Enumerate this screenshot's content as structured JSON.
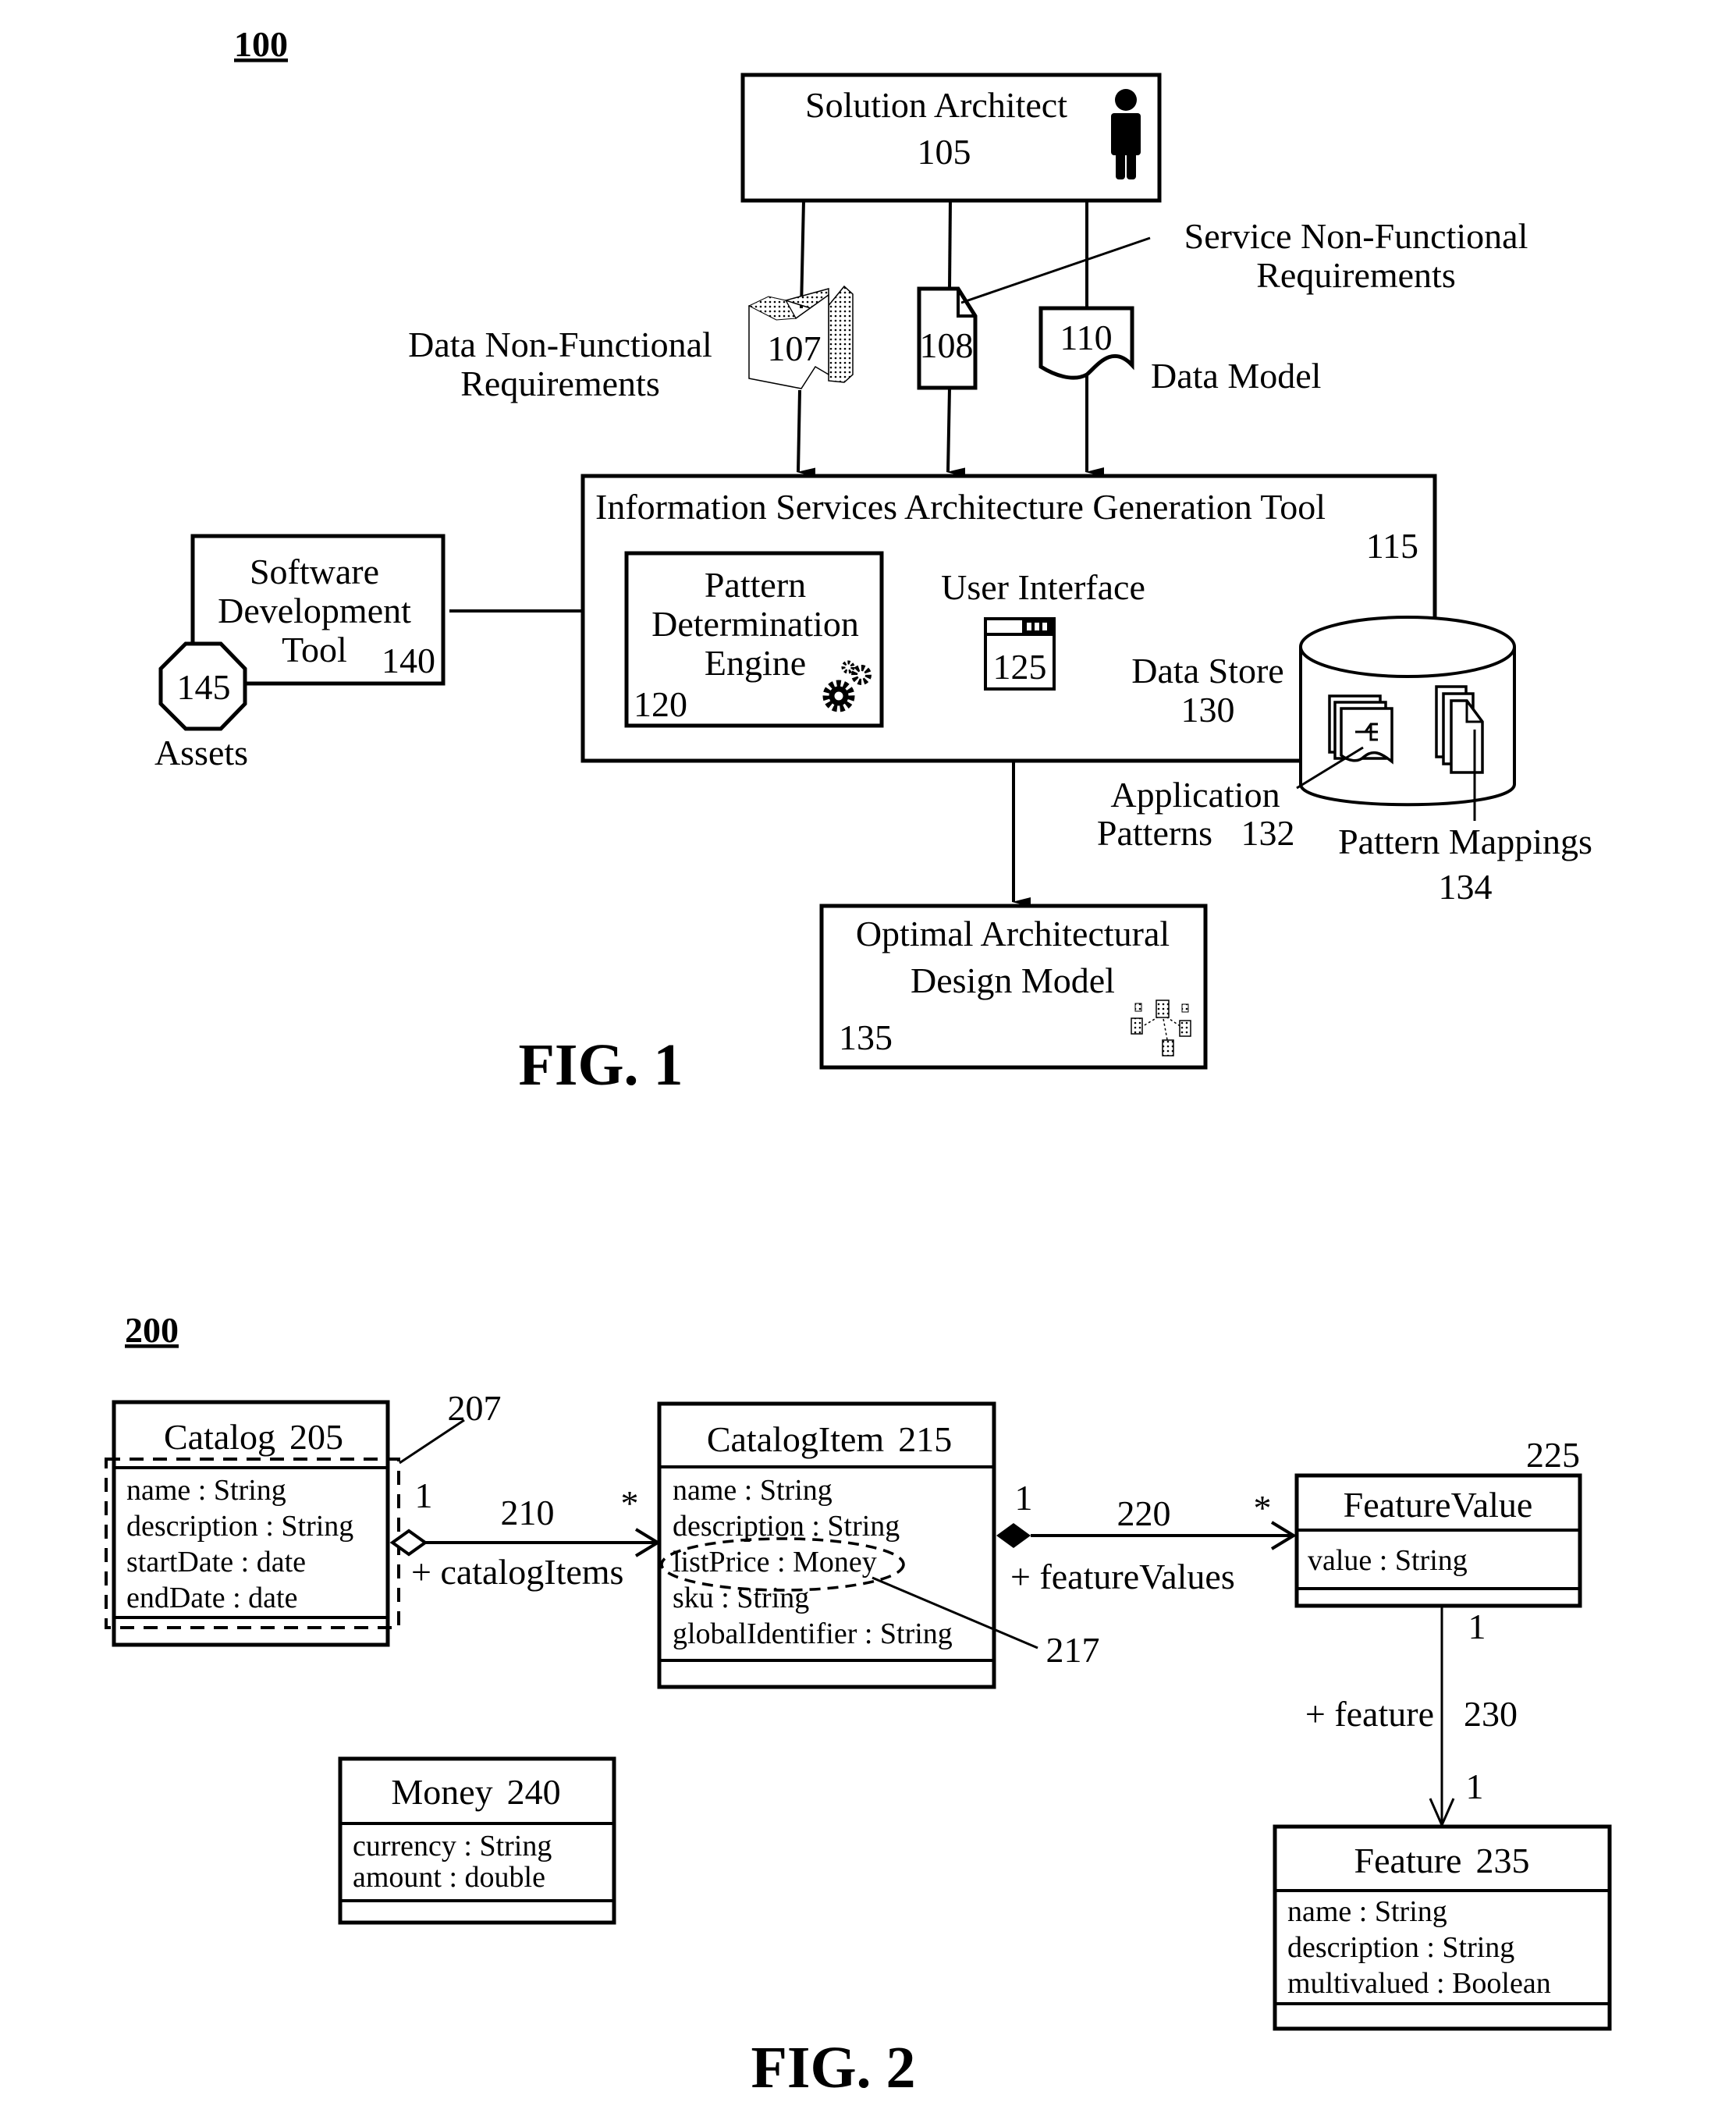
{
  "fig1": {
    "ref": "100",
    "caption": "FIG. 1",
    "solution_architect": {
      "title": "Solution Architect",
      "num": "105",
      "icon": "person-icon"
    },
    "doc107": {
      "num": "107",
      "label_line1": "Data Non-Functional",
      "label_line2": "Requirements",
      "icon": "dotted-document-icon"
    },
    "doc108": {
      "num": "108",
      "label_line1": "Service Non-Functional",
      "label_line2": "Requirements",
      "icon": "folded-document-icon"
    },
    "doc110": {
      "num": "110",
      "label": "Data Model",
      "icon": "wavy-document-icon"
    },
    "tool": {
      "title": "Information Services Architecture Generation Tool",
      "num": "115"
    },
    "engine": {
      "line1": "Pattern",
      "line2": "Determination",
      "line3": "Engine",
      "num": "120",
      "icon": "gears-icon"
    },
    "ui": {
      "label": "User Interface",
      "num": "125",
      "icon": "window-icon"
    },
    "datastore": {
      "line1": "Data Store",
      "num": "130",
      "icon": "database-cylinder-icon"
    },
    "app_patterns": {
      "line1": "Application",
      "line2": "Patterns",
      "num": "132",
      "icon": "stacked-pattern-documents-icon"
    },
    "pattern_mappings": {
      "line1": "Pattern Mappings",
      "num": "134",
      "icon": "stacked-pages-icon"
    },
    "optimal": {
      "line1": "Optimal Architectural",
      "line2": "Design Model",
      "num": "135",
      "icon": "model-graph-icon"
    },
    "sdt": {
      "line1": "Software",
      "line2": "Development",
      "line3": "Tool",
      "num": "140"
    },
    "assets": {
      "num": "145",
      "label": "Assets",
      "icon": "octagon-icon"
    }
  },
  "fig2": {
    "ref": "200",
    "caption": "FIG. 2",
    "catalog": {
      "name": "Catalog",
      "num": "205",
      "attrs": [
        "name : String",
        "description : String",
        "startDate : date",
        "endDate : date"
      ]
    },
    "callout207": "207",
    "assoc210": {
      "num": "210",
      "src_mult": "1",
      "dst_mult": "*",
      "role": "+ catalogItems"
    },
    "catalog_item": {
      "name": "CatalogItem",
      "num": "215",
      "attrs": [
        "name : String",
        "description : String",
        "listPrice : Money",
        "sku : String",
        "globalIdentifier : String"
      ]
    },
    "callout217": "217",
    "assoc220": {
      "num": "220",
      "src_mult": "1",
      "dst_mult": "*",
      "role": "+ featureValues"
    },
    "feature_value": {
      "name": "FeatureValue",
      "num": "225",
      "attrs": [
        "value : String"
      ]
    },
    "assoc230": {
      "num": "230",
      "src_mult": "1",
      "dst_mult": "1",
      "role": "+ feature"
    },
    "feature": {
      "name": "Feature",
      "num": "235",
      "attrs": [
        "name : String",
        "description : String",
        "multivalued : Boolean"
      ]
    },
    "money": {
      "name": "Money",
      "num": "240",
      "attrs": [
        "currency : String",
        "amount : double"
      ]
    }
  }
}
